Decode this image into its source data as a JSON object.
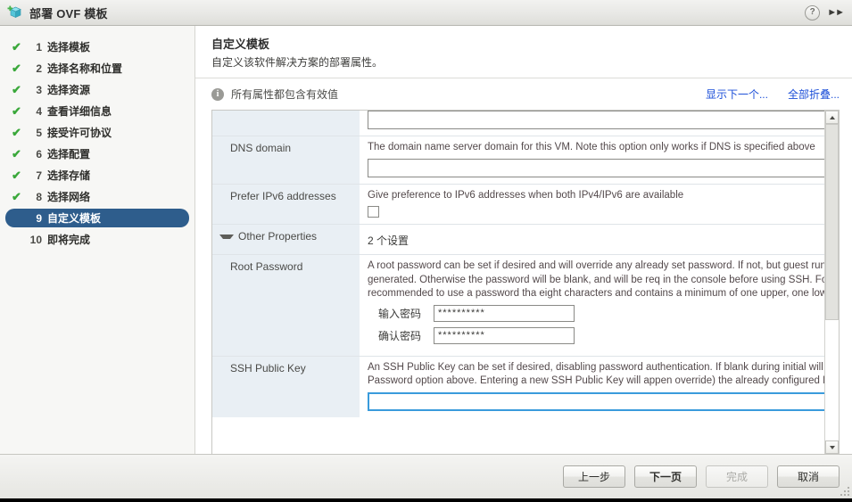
{
  "window": {
    "title": "部署 OVF 模板",
    "app_icon": "ovf-box-icon",
    "help_icon": "?",
    "expand_icon": "▶▶"
  },
  "sidebar": {
    "items": [
      {
        "num": "1",
        "label": "选择模板",
        "done": true,
        "selected": false,
        "check": "✔"
      },
      {
        "num": "2",
        "label": "选择名称和位置",
        "done": true,
        "selected": false,
        "check": "✔"
      },
      {
        "num": "3",
        "label": "选择资源",
        "done": true,
        "selected": false,
        "check": "✔"
      },
      {
        "num": "4",
        "label": "查看详细信息",
        "done": true,
        "selected": false,
        "check": "✔"
      },
      {
        "num": "5",
        "label": "接受许可协议",
        "done": true,
        "selected": false,
        "check": "✔"
      },
      {
        "num": "6",
        "label": "选择配置",
        "done": true,
        "selected": false,
        "check": "✔"
      },
      {
        "num": "7",
        "label": "选择存储",
        "done": true,
        "selected": false,
        "check": "✔"
      },
      {
        "num": "8",
        "label": "选择网络",
        "done": true,
        "selected": false,
        "check": "✔"
      },
      {
        "num": "9",
        "label": "自定义模板",
        "done": false,
        "selected": true,
        "check": ""
      },
      {
        "num": "10",
        "label": "即将完成",
        "done": false,
        "selected": false,
        "check": ""
      }
    ]
  },
  "content": {
    "title": "自定义模板",
    "subtitle": "自定义该软件解决方案的部署属性。",
    "notice": "所有属性都包含有效值",
    "link_show_next": "显示下一个...",
    "link_collapse_all": "全部折叠..."
  },
  "properties": {
    "row_partial": {
      "label": "",
      "input_value": "",
      "placeholder": ""
    },
    "dns_domain": {
      "label": "DNS domain",
      "description": "The domain name server domain for this VM. Note this option only works if DNS is specified above",
      "input_value": "",
      "placeholder": ""
    },
    "prefer_ipv6": {
      "label": "Prefer IPv6 addresses",
      "description": "Give preference to IPv6 addresses when both IPv4/IPv6 are available",
      "checked": false
    },
    "other_properties": {
      "label": "Other Properties",
      "value": "2 个设置",
      "expanded": true
    },
    "root_password": {
      "label": "Root Password",
      "description": "A root password can be set if desired and will override any already set password. If not, but guest running, then it will be randomly generated. Otherwise the password will be blank, and will be req in the console before using SSH. For security reasons, it is recommended to use a password tha eight characters and contains a minimum of one upper, one lower, one digit, and one special cha",
      "enter_label": "输入密码",
      "enter_value": "**********",
      "confirm_label": "确认密码",
      "confirm_value": "**********"
    },
    "ssh_public_key": {
      "label": "SSH Public Key",
      "description": "An SSH Public Key can be set if desired, disabling password authentication. If blank during initial will be configured per the Root Password option above. Entering a new SSH Public Key will appen override) the already configured Public Key(s).",
      "input_value": "",
      "placeholder": "",
      "focused": true
    }
  },
  "footer": {
    "back": "上一步",
    "next": "下一页",
    "finish": "完成",
    "cancel": "取消"
  },
  "colors": {
    "selected_nav": "#2e5d8c",
    "check_green": "#3aa83a",
    "link_blue": "#1c4fd8",
    "focus_blue": "#3a9bdc",
    "label_bg": "#e9eff4"
  }
}
